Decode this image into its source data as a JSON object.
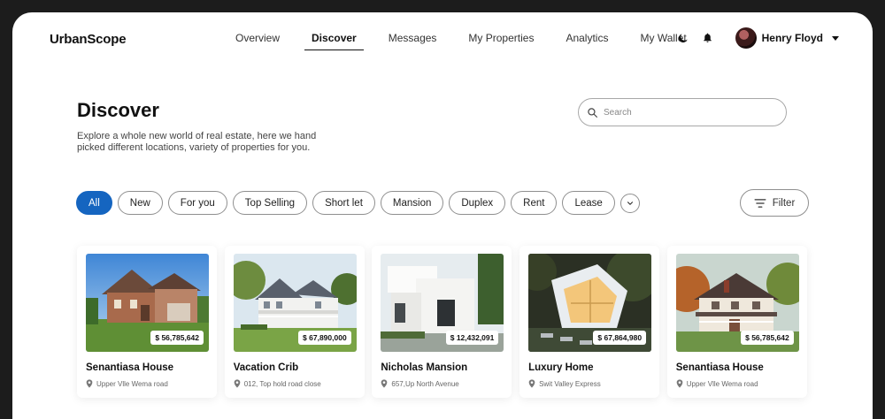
{
  "app": {
    "logo": "UrbanScope"
  },
  "nav": {
    "items": [
      {
        "label": "Overview"
      },
      {
        "label": "Discover"
      },
      {
        "label": "Messages"
      },
      {
        "label": "My Properties"
      },
      {
        "label": "Analytics"
      },
      {
        "label": "My Wallet"
      }
    ],
    "active_index": 1
  },
  "header": {
    "theme_icon": "moon-icon",
    "notification_icon": "bell-icon",
    "user_name": "Henry Floyd"
  },
  "page": {
    "title": "Discover",
    "description": "Explore a whole new world of real estate, here we hand picked different locations, variety of properties for you."
  },
  "search": {
    "placeholder": "Search"
  },
  "filters": {
    "chips": [
      "All",
      "New",
      "For you",
      "Top Selling",
      "Short let",
      "Mansion",
      "Duplex",
      "Rent",
      "Lease"
    ],
    "active_chip": "All",
    "filter_label": "Filter"
  },
  "colors": {
    "accent": "#1565c0"
  },
  "properties": [
    {
      "name": "Senantiasa House",
      "price": "$ 56,785,642",
      "location": "Upper Vlle Wema road",
      "image": "brick-house"
    },
    {
      "name": "Vacation Crib",
      "price": "$ 67,890,000",
      "location": "012, Top hold road close",
      "image": "white-farmhouse"
    },
    {
      "name": "Nicholas Mansion",
      "price": "$ 12,432,091",
      "location": "657,Up North Avenue",
      "image": "modern-white-mansion"
    },
    {
      "name": "Luxury Home",
      "price": "$ 67,864,980",
      "location": "Swit Valley Express",
      "image": "modern-glass-home"
    },
    {
      "name": "Senantiasa House",
      "price": "$ 56,785,642",
      "location": "Upper Vlle Wema road",
      "image": "classic-cottage"
    }
  ]
}
